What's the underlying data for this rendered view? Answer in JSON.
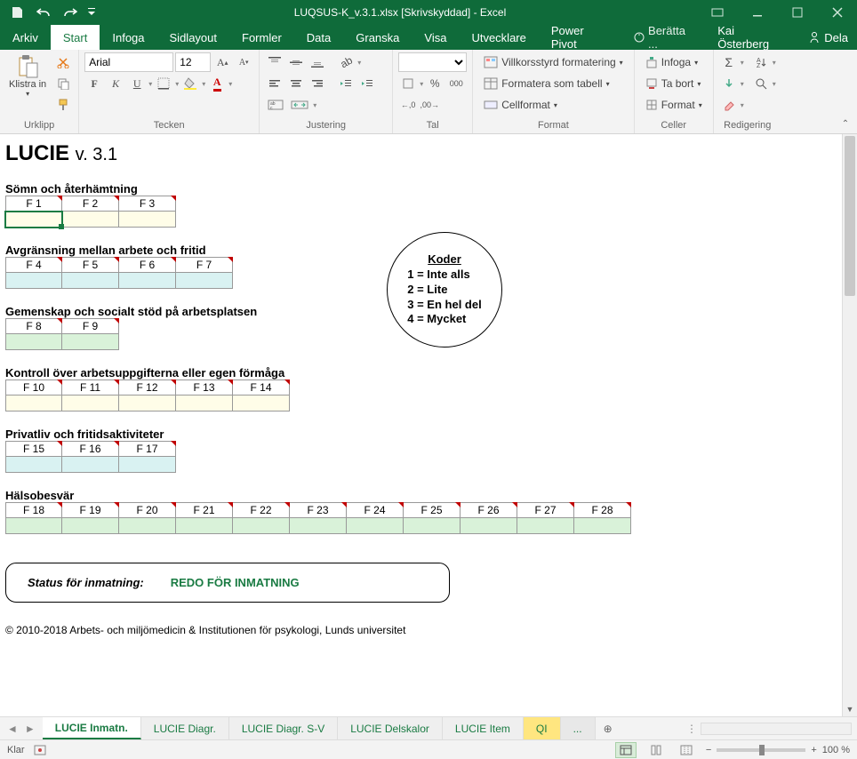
{
  "titlebar": {
    "title": "LUQSUS-K_v.3.1.xlsx  [Skrivskyddad] - Excel"
  },
  "menu": {
    "file": "Arkiv",
    "home": "Start",
    "insert": "Infoga",
    "layout": "Sidlayout",
    "formulas": "Formler",
    "data": "Data",
    "review": "Granska",
    "view": "Visa",
    "developer": "Utvecklare",
    "powerpivot": "Power Pivot",
    "tellme": "Berätta ...",
    "user": "Kai Österberg",
    "share": "Dela"
  },
  "ribbon": {
    "clipboard": {
      "paste": "Klistra in",
      "label": "Urklipp"
    },
    "font": {
      "name": "Arial",
      "size": "12",
      "label": "Tecken"
    },
    "align": {
      "label": "Justering"
    },
    "number": {
      "label": "Tal"
    },
    "styles": {
      "cond": "Villkorsstyrd formatering",
      "table": "Formatera som tabell",
      "cell": "Cellformat",
      "label": "Format"
    },
    "cells": {
      "insert": "Infoga",
      "delete": "Ta bort",
      "format": "Format",
      "label": "Celler"
    },
    "editing": {
      "label": "Redigering"
    }
  },
  "doc": {
    "title": "LUCIE",
    "version": "v. 3.1",
    "sections": [
      {
        "title": "Sömn och återhämtning",
        "color": "c-yellow",
        "items": [
          "F 1",
          "F 2",
          "F 3"
        ],
        "selectedFirst": true
      },
      {
        "title": "Avgränsning mellan arbete och fritid",
        "color": "c-cyan",
        "items": [
          "F 4",
          "F 5",
          "F 6",
          "F 7"
        ]
      },
      {
        "title": "Gemenskap och socialt stöd på arbetsplatsen",
        "color": "c-green",
        "items": [
          "F 8",
          "F 9"
        ]
      },
      {
        "title": "Kontroll över arbetsuppgifterna eller egen förmåga",
        "color": "c-yellow",
        "items": [
          "F 10",
          "F 11",
          "F 12",
          "F 13",
          "F 14"
        ]
      },
      {
        "title": "Privatliv och fritidsaktiviteter",
        "color": "c-cyan",
        "items": [
          "F 15",
          "F 16",
          "F 17"
        ]
      },
      {
        "title": "Hälsobesvär",
        "color": "c-green",
        "items": [
          "F 18",
          "F 19",
          "F 20",
          "F 21",
          "F 22",
          "F 23",
          "F 24",
          "F 25",
          "F 26",
          "F 27",
          "F 28"
        ]
      }
    ],
    "koder": {
      "heading": "Koder",
      "lines": [
        "1 = Inte alls",
        "2 = Lite",
        "3 = En hel del",
        "4 = Mycket"
      ]
    },
    "status": {
      "label": "Status för inmatning:",
      "value": "REDO FÖR INMATNING"
    },
    "copyright": "© 2010-2018 Arbets- och miljömedicin & Institutionen för psykologi, Lunds universitet"
  },
  "tabs": {
    "list": [
      "LUCIE Inmatn.",
      "LUCIE Diagr.",
      "LUCIE Diagr. S-V",
      "LUCIE Delskalor",
      "LUCIE Item"
    ],
    "partial": "QI",
    "activeIndex": 0
  },
  "statusbar": {
    "ready": "Klar",
    "zoom": "100 %"
  }
}
